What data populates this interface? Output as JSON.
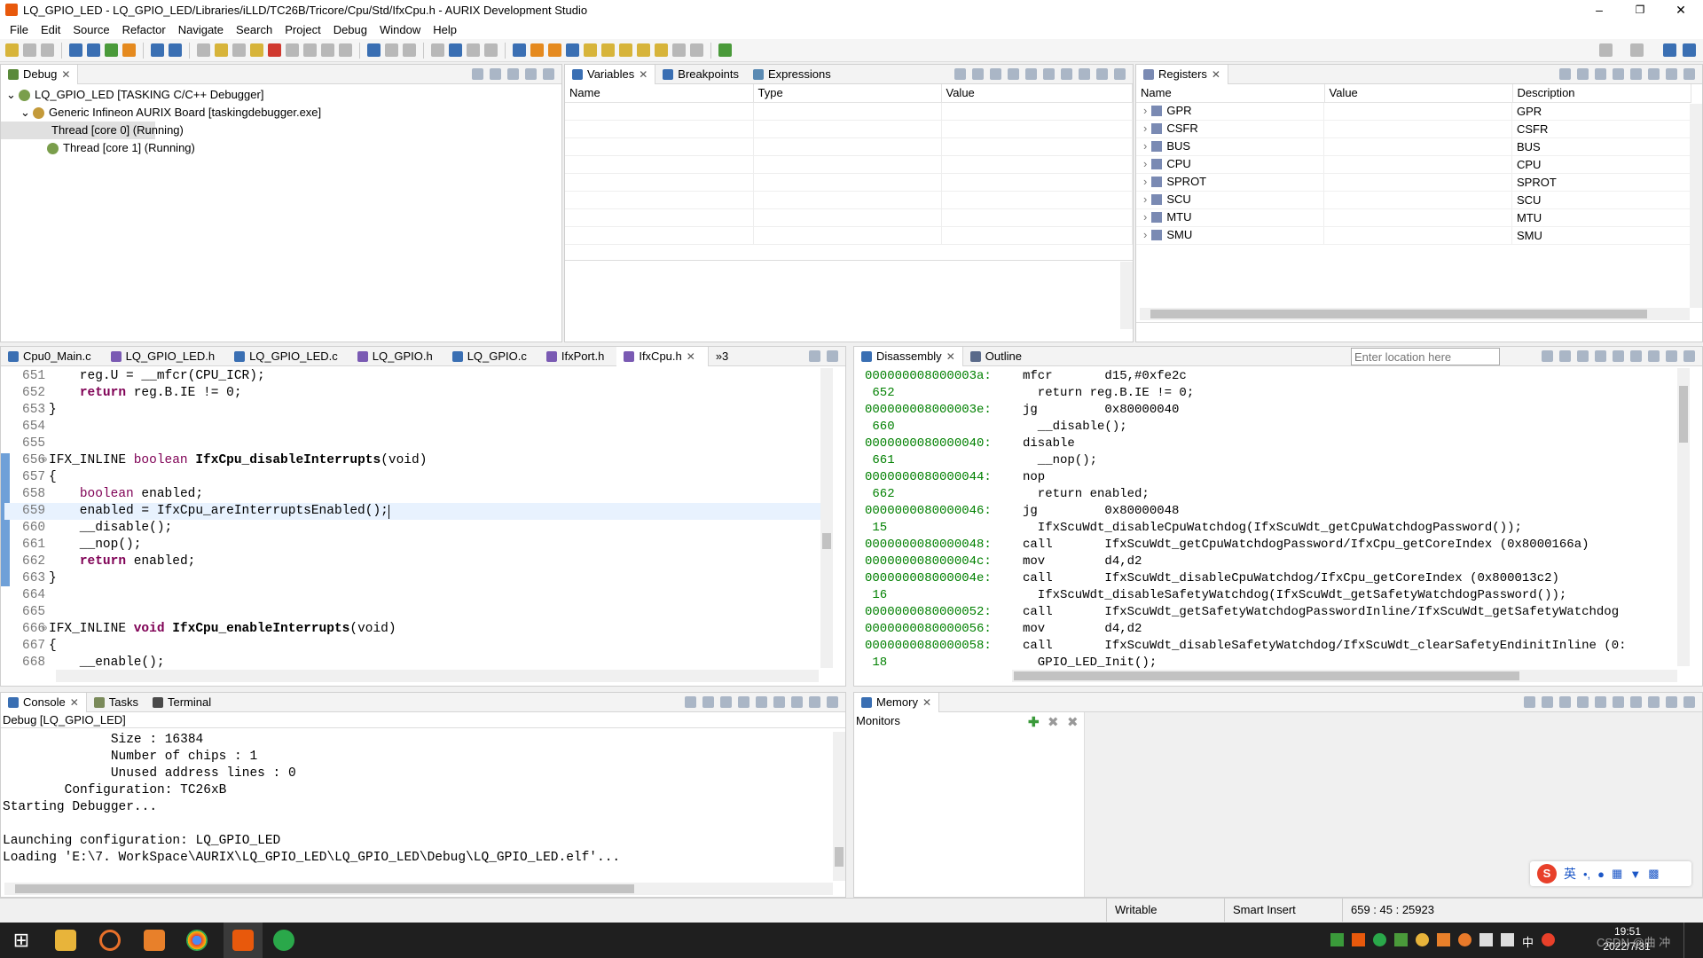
{
  "window": {
    "title": "LQ_GPIO_LED - LQ_GPIO_LED/Libraries/iLLD/TC26B/Tricore/Cpu/Std/IfxCpu.h - AURIX Development Studio",
    "min": "–",
    "max": "❐",
    "close": "✕"
  },
  "menu": [
    "File",
    "Edit",
    "Source",
    "Refactor",
    "Navigate",
    "Search",
    "Project",
    "Debug",
    "Window",
    "Help"
  ],
  "debug_view": {
    "tab": "Debug",
    "items": [
      {
        "label": "LQ_GPIO_LED [TASKING C/C++ Debugger]",
        "expander": "⌄"
      },
      {
        "label": "Generic Infineon AURIX Board [taskingdebugger.exe]",
        "expander": "⌄"
      },
      {
        "label": "Thread [core 0] (Running)",
        "selected": true
      },
      {
        "label": "Thread [core 1] (Running)"
      }
    ]
  },
  "variables_view": {
    "tabs": [
      "Variables",
      "Breakpoints",
      "Expressions"
    ],
    "columns": [
      "Name",
      "Type",
      "Value"
    ]
  },
  "registers_view": {
    "tab": "Registers",
    "columns": [
      "Name",
      "Value",
      "Description"
    ],
    "rows": [
      {
        "name": "GPR",
        "desc": "GPR"
      },
      {
        "name": "CSFR",
        "desc": "CSFR"
      },
      {
        "name": "BUS",
        "desc": "BUS"
      },
      {
        "name": "CPU",
        "desc": "CPU"
      },
      {
        "name": "SPROT",
        "desc": "SPROT"
      },
      {
        "name": "SCU",
        "desc": "SCU"
      },
      {
        "name": "MTU",
        "desc": "MTU"
      },
      {
        "name": "SMU",
        "desc": "SMU"
      }
    ]
  },
  "editor": {
    "tabs": [
      "Cpu0_Main.c",
      "LQ_GPIO_LED.h",
      "LQ_GPIO_LED.c",
      "LQ_GPIO.h",
      "LQ_GPIO.c",
      "IfxPort.h",
      "IfxCpu.h"
    ],
    "active_tab": "IfxCpu.h",
    "overflow": "»3",
    "lines": [
      {
        "n": "651",
        "t": "    reg.U = __mfcr(CPU_ICR);"
      },
      {
        "n": "652",
        "t": "    ",
        "kw": "return",
        "rest": " reg.B.IE != 0;"
      },
      {
        "n": "653",
        "t": "}"
      },
      {
        "n": "654",
        "t": ""
      },
      {
        "n": "655",
        "t": ""
      },
      {
        "n": "656",
        "t": "IFX_INLINE ",
        "kw2": "boolean",
        "fn": " IfxCpu_disableInterrupts",
        "rest": "(void)",
        "fold": true
      },
      {
        "n": "657",
        "t": "{"
      },
      {
        "n": "658",
        "t": "    ",
        "kw2": "boolean",
        "rest": " enabled;"
      },
      {
        "n": "659",
        "t": "    enabled = IfxCpu_areInterruptsEnabled();",
        "current": true
      },
      {
        "n": "660",
        "t": "    __disable();"
      },
      {
        "n": "661",
        "t": "    __nop();"
      },
      {
        "n": "662",
        "t": "    ",
        "kw": "return",
        "rest": " enabled;"
      },
      {
        "n": "663",
        "t": "}"
      },
      {
        "n": "664",
        "t": ""
      },
      {
        "n": "665",
        "t": ""
      },
      {
        "n": "666",
        "t": "IFX_INLINE ",
        "kw": "void",
        "fn": " IfxCpu_enableInterrupts",
        "rest": "(void)",
        "fold": true
      },
      {
        "n": "667",
        "t": "{"
      },
      {
        "n": "668",
        "t": "    __enable();"
      }
    ]
  },
  "disassembly": {
    "tabs": [
      "Disassembly",
      "Outline"
    ],
    "location_placeholder": "Enter location here",
    "lines": [
      {
        "a": "000000008000003a:",
        "o": "mfcr       d15,#0xfe2c"
      },
      {
        "a": " 652",
        "o": "  return reg.B.IE != 0;"
      },
      {
        "a": "000000008000003e:",
        "o": "jg         0x80000040"
      },
      {
        "a": " 660",
        "o": "  __disable();"
      },
      {
        "a": "0000000080000040:",
        "o": "disable"
      },
      {
        "a": " 661",
        "o": "  __nop();"
      },
      {
        "a": "0000000080000044:",
        "o": "nop"
      },
      {
        "a": " 662",
        "o": "  return enabled;"
      },
      {
        "a": "0000000080000046:",
        "o": "jg         0x80000048"
      },
      {
        "a": " 15",
        "o": "  IfxScuWdt_disableCpuWatchdog(IfxScuWdt_getCpuWatchdogPassword());"
      },
      {
        "a": "0000000080000048:",
        "o": "call       IfxScuWdt_getCpuWatchdogPassword/IfxCpu_getCoreIndex (0x8000166a)"
      },
      {
        "a": "000000008000004c:",
        "o": "mov        d4,d2"
      },
      {
        "a": "000000008000004e:",
        "o": "call       IfxScuWdt_disableCpuWatchdog/IfxCpu_getCoreIndex (0x800013c2)"
      },
      {
        "a": " 16",
        "o": "  IfxScuWdt_disableSafetyWatchdog(IfxScuWdt_getSafetyWatchdogPassword());"
      },
      {
        "a": "0000000080000052:",
        "o": "call       IfxScuWdt_getSafetyWatchdogPasswordInline/IfxScuWdt_getSafetyWatchdog"
      },
      {
        "a": "0000000080000056:",
        "o": "mov        d4,d2"
      },
      {
        "a": "0000000080000058:",
        "o": "call       IfxScuWdt_disableSafetyWatchdog/IfxScuWdt_clearSafetyEndinitInline (0:"
      },
      {
        "a": " 18",
        "o": "  GPIO_LED_Init();"
      }
    ]
  },
  "console": {
    "tabs": [
      "Console",
      "Tasks",
      "Terminal"
    ],
    "subtitle": "Debug [LQ_GPIO_LED]",
    "lines": [
      "              Size : 16384",
      "              Number of chips : 1",
      "              Unused address lines : 0",
      "        Configuration: TC26xB",
      "Starting Debugger...",
      "",
      "Launching configuration: LQ_GPIO_LED",
      "Loading 'E:\\7. WorkSpace\\AURIX\\LQ_GPIO_LED\\LQ_GPIO_LED\\Debug\\LQ_GPIO_LED.elf'..."
    ]
  },
  "memory": {
    "tab": "Memory",
    "monitors_label": "Monitors"
  },
  "status": {
    "writable": "Writable",
    "insert": "Smart Insert",
    "position": "659 : 45 : 25923"
  },
  "taskbar": {
    "time": "19:51",
    "date": "2022/7/31",
    "watermark": "CSDN @曲 冲",
    "ime_label": "英",
    "ime_char": "中"
  },
  "colors": {
    "accent": "#e8590c",
    "keyword": "#7f0055",
    "address": "#008000"
  }
}
